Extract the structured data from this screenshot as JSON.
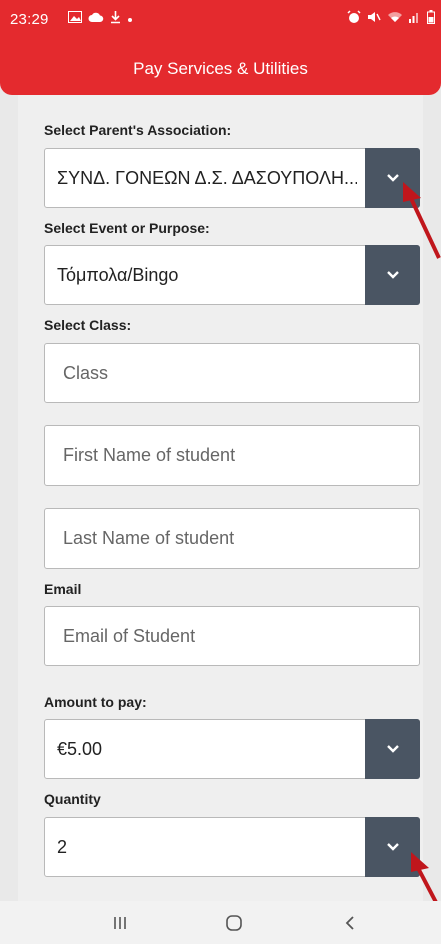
{
  "status": {
    "time": "23:29"
  },
  "header": {
    "title": "Pay Services & Utilities"
  },
  "form": {
    "association": {
      "label": "Select Parent's Association:",
      "value": "ΣΥΝΔ. ΓΟΝΕΩΝ Δ.Σ. ΔΑΣΟΥΠΟΛΗ..."
    },
    "event": {
      "label": "Select Event or Purpose:",
      "value": "Τόμπολα/Bingo"
    },
    "class": {
      "label": "Select Class:",
      "placeholder": "Class"
    },
    "first_name": {
      "placeholder": "First Name of student"
    },
    "last_name": {
      "placeholder": "Last Name of student"
    },
    "email": {
      "label": "Email",
      "placeholder": "Email of Student"
    },
    "amount": {
      "label": "Amount to pay:",
      "value": "€5.00"
    },
    "quantity": {
      "label": "Quantity",
      "value": "2"
    }
  },
  "colors": {
    "accent": "#e42a2e",
    "dropdown_button": "#4a5563",
    "annotation_arrow": "#c0161c"
  }
}
